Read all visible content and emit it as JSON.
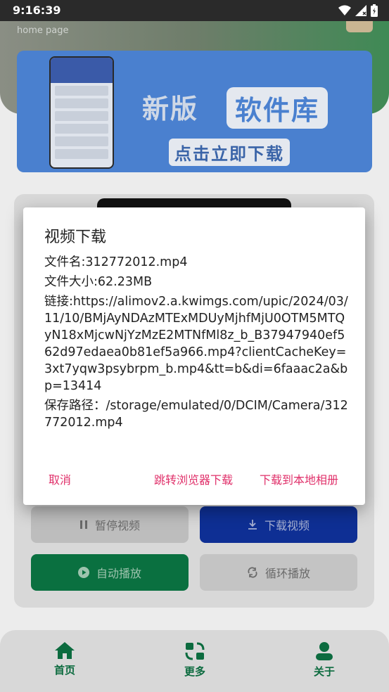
{
  "status_bar": {
    "time": "9:16:39"
  },
  "header": {
    "home_label": "home page"
  },
  "banner": {
    "title_part1": "新版",
    "title_part2": "软件库",
    "subtitle": "点击立即下载"
  },
  "controls": {
    "pause_label": "暂停视频",
    "download_label": "下载视频",
    "autoplay_label": "自动播放",
    "loop_label": "循环播放"
  },
  "nav": {
    "items": [
      {
        "label": "首页",
        "icon": "home-icon"
      },
      {
        "label": "更多",
        "icon": "more-icon"
      },
      {
        "label": "关于",
        "icon": "user-icon"
      }
    ]
  },
  "dialog": {
    "title": "视频下载",
    "file_name": "文件名:312772012.mp4",
    "file_size": "文件大小:62.23MB",
    "link": "链接:https://alimov2.a.kwimgs.com/upic/2024/03/11/10/BMjAyNDAzMTExMDUyMjhfMjU0OTM5MTQyN18xMjcwNjYzMzE2MTNfMl8z_b_B37947940ef562d97edaea0b81ef5a966.mp4?clientCacheKey=3xt7yqw3psybrpm_b.mp4&tt=b&di=6faaac2a&bp=13414",
    "save_path": "保存路径：/storage/emulated/0/DCIM/Camera/312772012.mp4",
    "cancel_label": "取消",
    "browser_label": "跳转浏览器下载",
    "local_label": "下载到本地相册"
  },
  "colors": {
    "accent": "#e0306a",
    "green": "#0c6b3f",
    "blue": "#0e2f94"
  }
}
